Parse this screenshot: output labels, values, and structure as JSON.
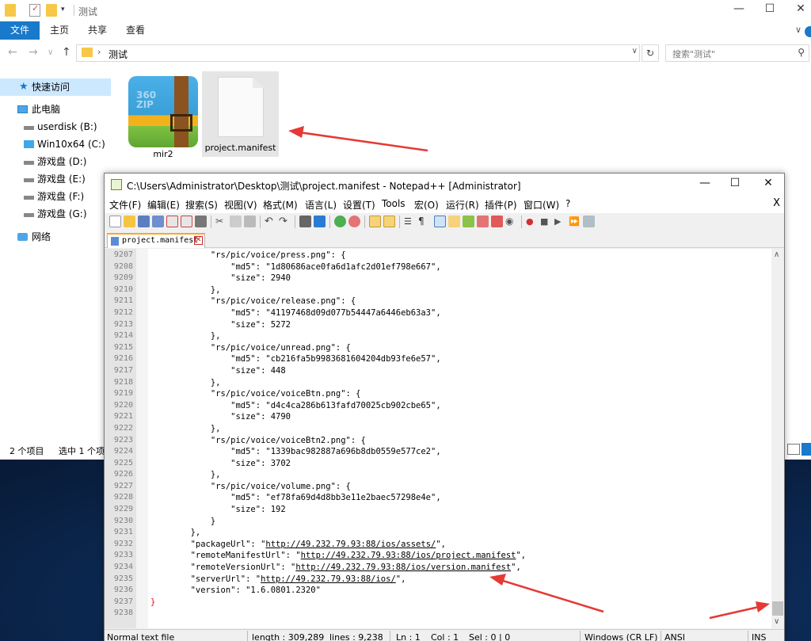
{
  "explorer": {
    "window_title": "测试",
    "ribbon_tabs": [
      "文件",
      "主页",
      "共享",
      "查看"
    ],
    "address": {
      "path": "测试",
      "search_placeholder": "搜索\"测试\""
    },
    "nav": [
      {
        "label": "快速访问",
        "icon": "star-icon"
      },
      {
        "label": "此电脑",
        "icon": "computer-icon"
      },
      {
        "label": "userdisk (B:)",
        "icon": "drive-icon"
      },
      {
        "label": "Win10x64 (C:)",
        "icon": "windows-drive-icon"
      },
      {
        "label": "游戏盘 (D:)",
        "icon": "drive-icon"
      },
      {
        "label": "游戏盘 (E:)",
        "icon": "drive-icon"
      },
      {
        "label": "游戏盘 (F:)",
        "icon": "drive-icon"
      },
      {
        "label": "游戏盘 (G:)",
        "icon": "drive-icon"
      },
      {
        "label": "网络",
        "icon": "network-icon"
      }
    ],
    "files": [
      {
        "name": "mir2",
        "type": "360zip-archive"
      },
      {
        "name": "project.manifest",
        "type": "file"
      }
    ],
    "status": {
      "count": "2 个项目",
      "selected": "选中 1 个项"
    }
  },
  "notepad": {
    "title": "C:\\Users\\Administrator\\Desktop\\测试\\project.manifest - Notepad++ [Administrator]",
    "menu": [
      "文件(F)",
      "编辑(E)",
      "搜索(S)",
      "视图(V)",
      "格式(M)",
      "语言(L)",
      "设置(T)",
      "Tools",
      "宏(O)",
      "运行(R)",
      "插件(P)",
      "窗口(W)",
      "?"
    ],
    "menu_close": "X",
    "tab_label": "project.manifest",
    "lines": [
      {
        "n": "9207",
        "t": "            \"rs/pic/voice/press.png\": {"
      },
      {
        "n": "9208",
        "t": "                \"md5\": \"1d80686ace0fa6d1afc2d01ef798e667\","
      },
      {
        "n": "9209",
        "t": "                \"size\": 2940"
      },
      {
        "n": "9210",
        "t": "            },"
      },
      {
        "n": "9211",
        "t": "            \"rs/pic/voice/release.png\": {"
      },
      {
        "n": "9212",
        "t": "                \"md5\": \"41197468d09d077b54447a6446eb63a3\","
      },
      {
        "n": "9213",
        "t": "                \"size\": 5272"
      },
      {
        "n": "9214",
        "t": "            },"
      },
      {
        "n": "9215",
        "t": "            \"rs/pic/voice/unread.png\": {"
      },
      {
        "n": "9216",
        "t": "                \"md5\": \"cb216fa5b9983681604204db93fe6e57\","
      },
      {
        "n": "9217",
        "t": "                \"size\": 448"
      },
      {
        "n": "9218",
        "t": "            },"
      },
      {
        "n": "9219",
        "t": "            \"rs/pic/voice/voiceBtn.png\": {"
      },
      {
        "n": "9220",
        "t": "                \"md5\": \"d4c4ca286b613fafd70025cb902cbe65\","
      },
      {
        "n": "9221",
        "t": "                \"size\": 4790"
      },
      {
        "n": "9222",
        "t": "            },"
      },
      {
        "n": "9223",
        "t": "            \"rs/pic/voice/voiceBtn2.png\": {"
      },
      {
        "n": "9224",
        "t": "                \"md5\": \"1339bac982887a696b8db0559e577ce2\","
      },
      {
        "n": "9225",
        "t": "                \"size\": 3702"
      },
      {
        "n": "9226",
        "t": "            },"
      },
      {
        "n": "9227",
        "t": "            \"rs/pic/voice/volume.png\": {"
      },
      {
        "n": "9228",
        "t": "                \"md5\": \"ef78fa69d4d8bb3e11e2baec57298e4e\","
      },
      {
        "n": "9229",
        "t": "                \"size\": 192"
      },
      {
        "n": "9230",
        "t": "            }"
      },
      {
        "n": "9231",
        "t": "        },"
      },
      {
        "n": "9232",
        "pre": "        \"packageUrl\": \"",
        "link": "http://49.232.79.93:88/ios/assets/",
        "post": "\","
      },
      {
        "n": "9233",
        "pre": "        \"remoteManifestUrl\": \"",
        "link": "http://49.232.79.93:88/ios/project.manifest",
        "post": "\","
      },
      {
        "n": "9234",
        "pre": "        \"remoteVersionUrl\": \"",
        "link": "http://49.232.79.93:88/ios/version.manifest",
        "post": "\","
      },
      {
        "n": "9235",
        "pre": "        \"serverUrl\": \"",
        "link": "http://49.232.79.93:88/ios/",
        "post": "\","
      },
      {
        "n": "9236",
        "t": "        \"version\": \"1.6.0801.2320\""
      },
      {
        "n": "9237",
        "t": "}",
        "red": true
      },
      {
        "n": "9238",
        "t": ""
      }
    ],
    "status": {
      "type": "Normal text file",
      "length": "length : 309,289",
      "lines": "lines : 9,238",
      "ln": "Ln : 1",
      "col": "Col : 1",
      "sel": "Sel : 0 | 0",
      "eol": "Windows (CR LF)",
      "encoding": "ANSI",
      "mode": "INS"
    }
  },
  "colors": {
    "accent": "#1979ca",
    "selection": "#cce8ff",
    "arrow": "#e53935"
  }
}
